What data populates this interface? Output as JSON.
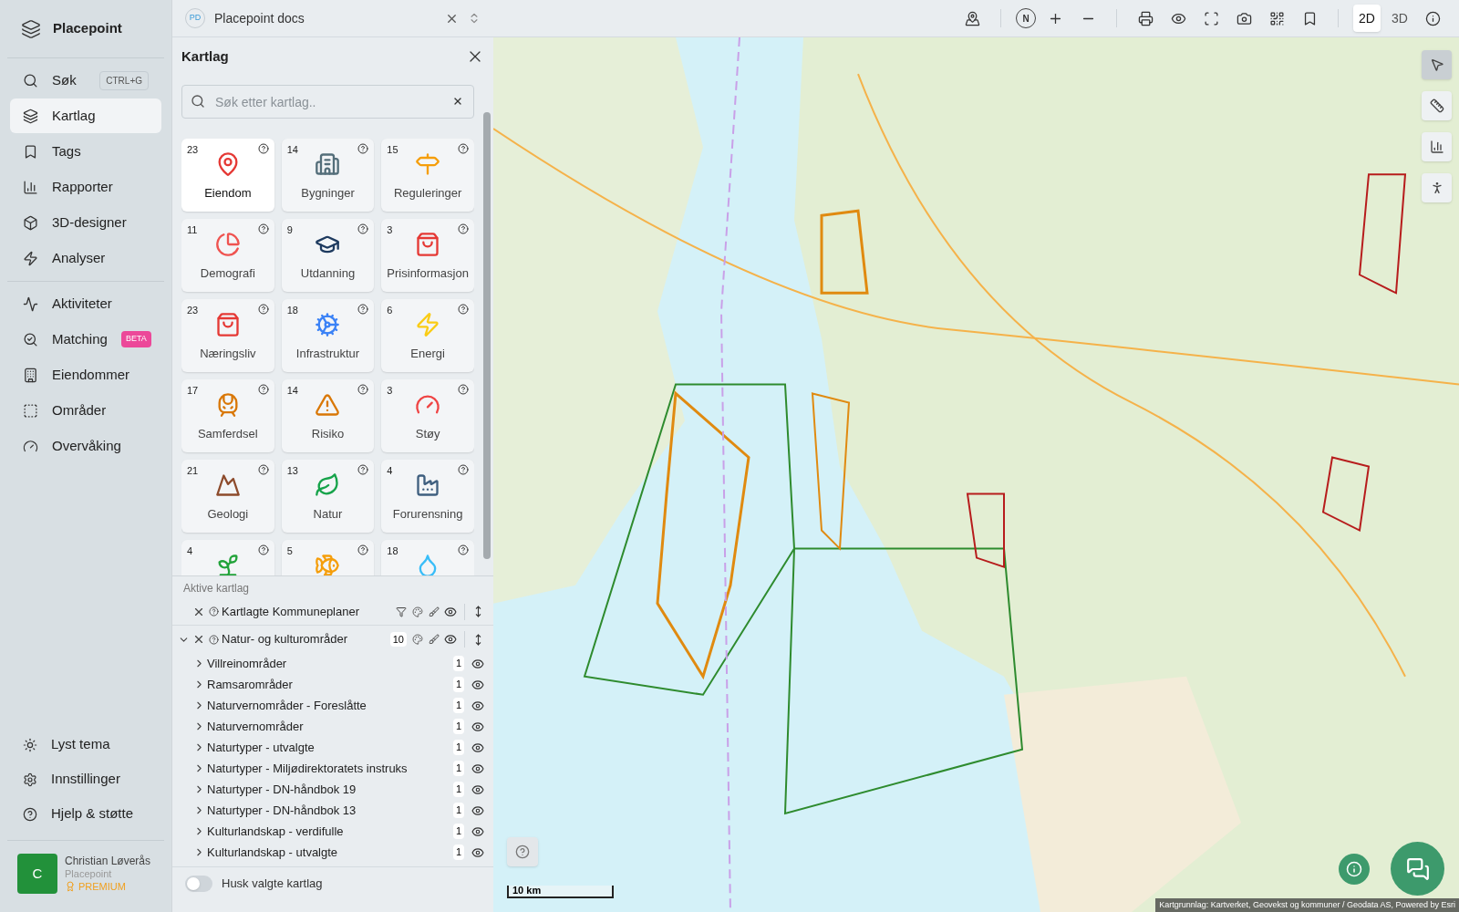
{
  "sidebar": {
    "brand": "Placepoint",
    "nav_groups": [
      [
        {
          "label": "Søk",
          "shortcut": "CTRL+G",
          "selected": false
        },
        {
          "label": "Kartlag",
          "selected": true
        },
        {
          "label": "Tags",
          "selected": false
        },
        {
          "label": "Rapporter",
          "selected": false
        },
        {
          "label": "3D-designer",
          "selected": false
        },
        {
          "label": "Analyser",
          "selected": false
        }
      ],
      [
        {
          "label": "Aktiviteter",
          "selected": false
        },
        {
          "label": "Matching",
          "badge": "BETA",
          "selected": false
        },
        {
          "label": "Eiendommer",
          "selected": false
        },
        {
          "label": "Områder",
          "selected": false
        },
        {
          "label": "Overvåking",
          "selected": false
        }
      ]
    ],
    "bottom_items": [
      "Lyst tema",
      "Innstillinger",
      "Hjelp & støtte"
    ],
    "user": {
      "initial": "C",
      "name": "Christian Løverås",
      "org": "Placepoint",
      "plan": "PREMIUM"
    }
  },
  "document": {
    "avatar": "PD",
    "title": "Placepoint docs"
  },
  "layers_panel": {
    "title": "Kartlag",
    "search": {
      "placeholder": "Søk etter kartlag.."
    },
    "categories": [
      {
        "count": "23",
        "label": "Eiendom",
        "selected": true
      },
      {
        "count": "14",
        "label": "Bygninger",
        "selected": false
      },
      {
        "count": "15",
        "label": "Reguleringer",
        "selected": false
      },
      {
        "count": "11",
        "label": "Demografi",
        "selected": false
      },
      {
        "count": "9",
        "label": "Utdanning",
        "selected": false
      },
      {
        "count": "3",
        "label": "Prisinformasjon",
        "selected": false
      },
      {
        "count": "23",
        "label": "Næringsliv",
        "selected": false
      },
      {
        "count": "18",
        "label": "Infrastruktur",
        "selected": false
      },
      {
        "count": "6",
        "label": "Energi",
        "selected": false
      },
      {
        "count": "17",
        "label": "Samferdsel",
        "selected": false
      },
      {
        "count": "14",
        "label": "Risiko",
        "selected": false
      },
      {
        "count": "3",
        "label": "Støy",
        "selected": false
      },
      {
        "count": "21",
        "label": "Geologi",
        "selected": false
      },
      {
        "count": "13",
        "label": "Natur",
        "selected": false
      },
      {
        "count": "4",
        "label": "Forurensning",
        "selected": false
      },
      {
        "count": "4",
        "selected": false
      },
      {
        "count": "5",
        "selected": false
      },
      {
        "count": "18",
        "selected": false
      }
    ],
    "active_title": "Aktive kartlag",
    "active_layers": [
      {
        "kind": "layer",
        "name": "Kartlagte Kommuneplaner"
      },
      {
        "kind": "group",
        "name": "Natur- og kulturområder",
        "count": "10",
        "expanded": true,
        "children": [
          {
            "name": "Villreinområder",
            "count": "1",
            "expanded": false
          },
          {
            "name": "Ramsarområder",
            "count": "1",
            "expanded": false
          },
          {
            "name": "Naturvernområder - Foreslåtte",
            "count": "1",
            "expanded": false
          },
          {
            "name": "Naturvernområder",
            "count": "1",
            "expanded": false
          },
          {
            "name": "Naturtyper - utvalgte",
            "count": "1",
            "expanded": false
          },
          {
            "name": "Naturtyper - Miljødirektoratets instruks",
            "count": "1",
            "expanded": false
          },
          {
            "name": "Naturtyper - DN-håndbok 19",
            "count": "1",
            "expanded": false
          },
          {
            "name": "Naturtyper - DN-håndbok 13",
            "count": "1",
            "expanded": false
          },
          {
            "name": "Kulturlandskap - verdifulle",
            "count": "1",
            "expanded": false
          },
          {
            "name": "Kulturlandskap - utvalgte",
            "count": "1",
            "expanded": false
          }
        ]
      }
    ],
    "remember": {
      "label": "Husk valgte kartlag",
      "on": false
    }
  },
  "map_toolbar": {
    "compass": "N",
    "view_modes": [
      {
        "label": "2D",
        "selected": true
      },
      {
        "label": "3D",
        "selected": false
      }
    ]
  },
  "map": {
    "scale": "10 km",
    "attribution": "Kartgrunnlag: Kartverket, Geovekst og kommuner / Geodata AS, Powered by Esri"
  }
}
